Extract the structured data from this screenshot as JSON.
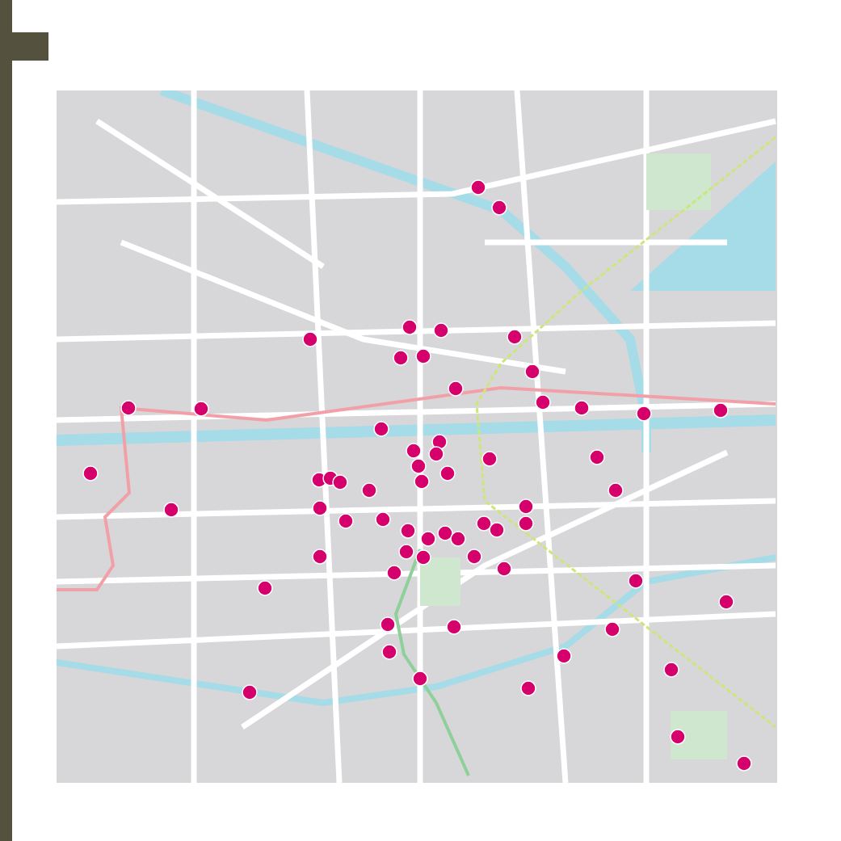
{
  "map": {
    "pins_visible": true
  }
}
